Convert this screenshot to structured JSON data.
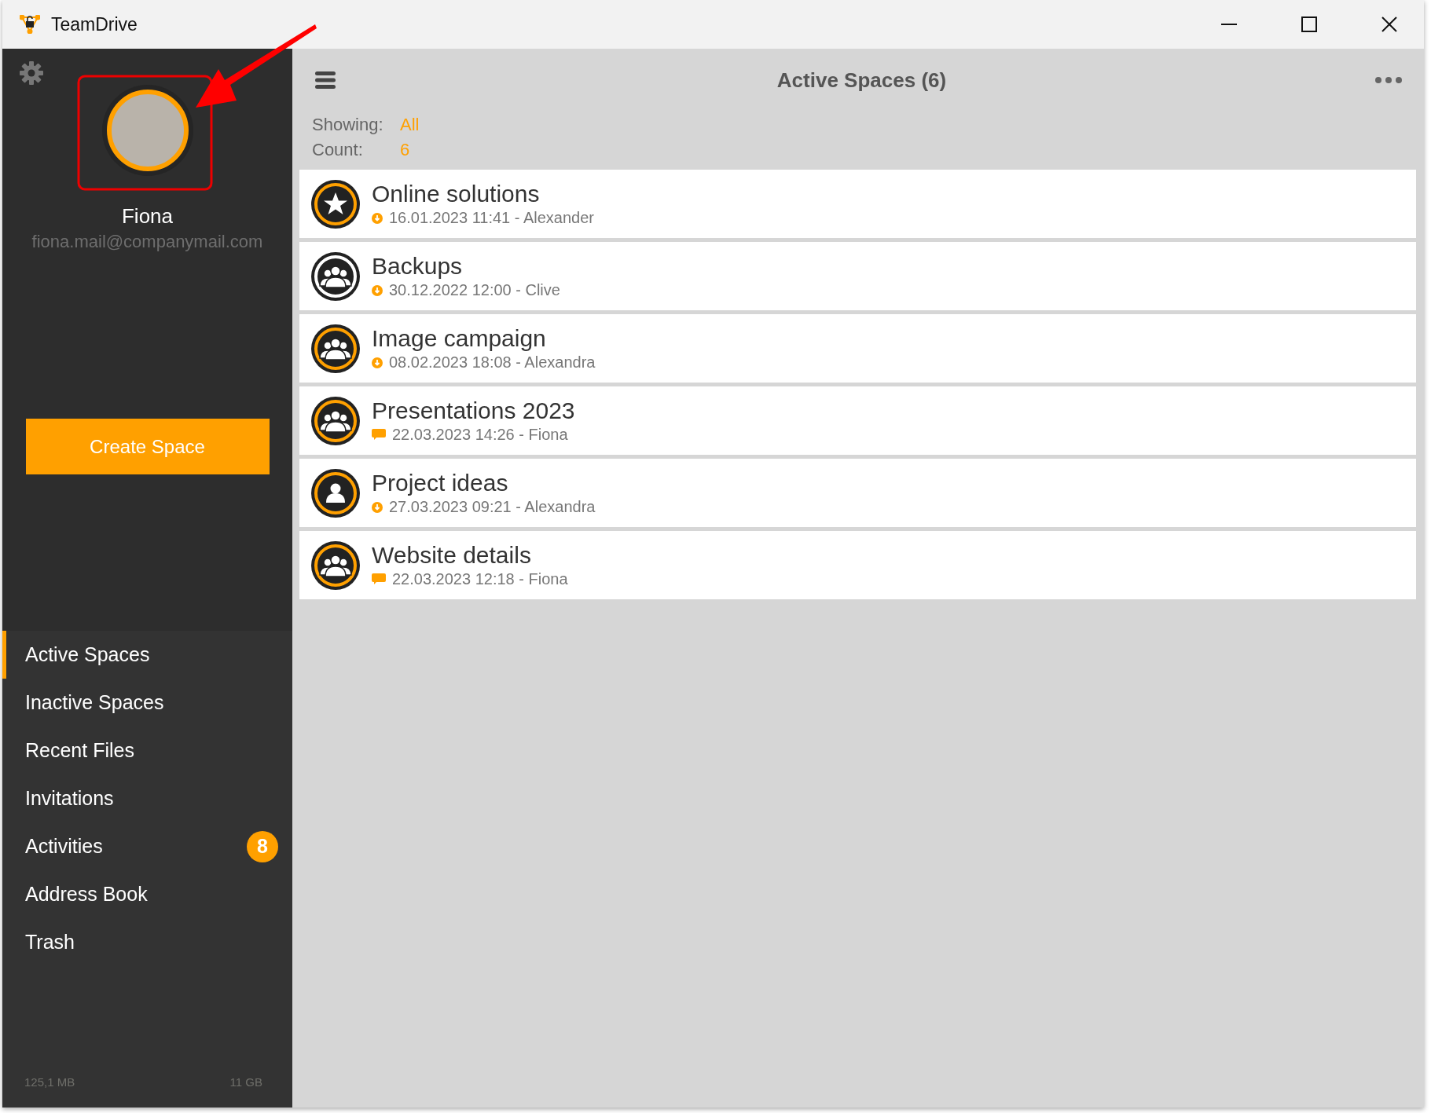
{
  "window": {
    "title": "TeamDrive"
  },
  "profile": {
    "name": "Fiona",
    "email": "fiona.mail@companymail.com"
  },
  "create_button": "Create Space",
  "nav": [
    {
      "label": "Active Spaces",
      "selected": true
    },
    {
      "label": "Inactive Spaces",
      "selected": false
    },
    {
      "label": "Recent Files",
      "selected": false
    },
    {
      "label": "Invitations",
      "selected": false
    },
    {
      "label": "Activities",
      "selected": false,
      "badge": "8"
    },
    {
      "label": "Address Book",
      "selected": false
    },
    {
      "label": "Trash",
      "selected": false
    }
  ],
  "storage": {
    "used": "125,1 MB",
    "total": "11 GB"
  },
  "header": {
    "title": "Active Spaces (6)"
  },
  "filter": {
    "showing_label": "Showing:",
    "showing_value": "All",
    "count_label": "Count:",
    "count_value": "6"
  },
  "spaces": [
    {
      "name": "Online solutions",
      "meta": "16.01.2023 11:41 - Alexander",
      "kind": "star",
      "color": "#ffa000",
      "activity": {
        "kind": "download"
      }
    },
    {
      "name": "Backups",
      "meta": "30.12.2022 12:00 - Clive",
      "kind": "group",
      "color": "#ffffff",
      "activity": {
        "kind": "download"
      }
    },
    {
      "name": "Image campaign",
      "meta": "08.02.2023 18:08 - Alexandra",
      "kind": "group",
      "color": "#ffa000",
      "activity": {
        "kind": "download"
      }
    },
    {
      "name": "Presentations 2023",
      "meta": "22.03.2023 14:26 - Fiona",
      "kind": "group",
      "color": "#ffa000",
      "activity": {
        "kind": "message"
      }
    },
    {
      "name": "Project ideas",
      "meta": "27.03.2023 09:21 - Alexandra",
      "kind": "person",
      "color": "#ffa000",
      "activity": {
        "kind": "download"
      }
    },
    {
      "name": "Website details",
      "meta": "22.03.2023 12:18 - Fiona",
      "kind": "group",
      "color": "#ffa000",
      "activity": {
        "kind": "message"
      }
    }
  ]
}
